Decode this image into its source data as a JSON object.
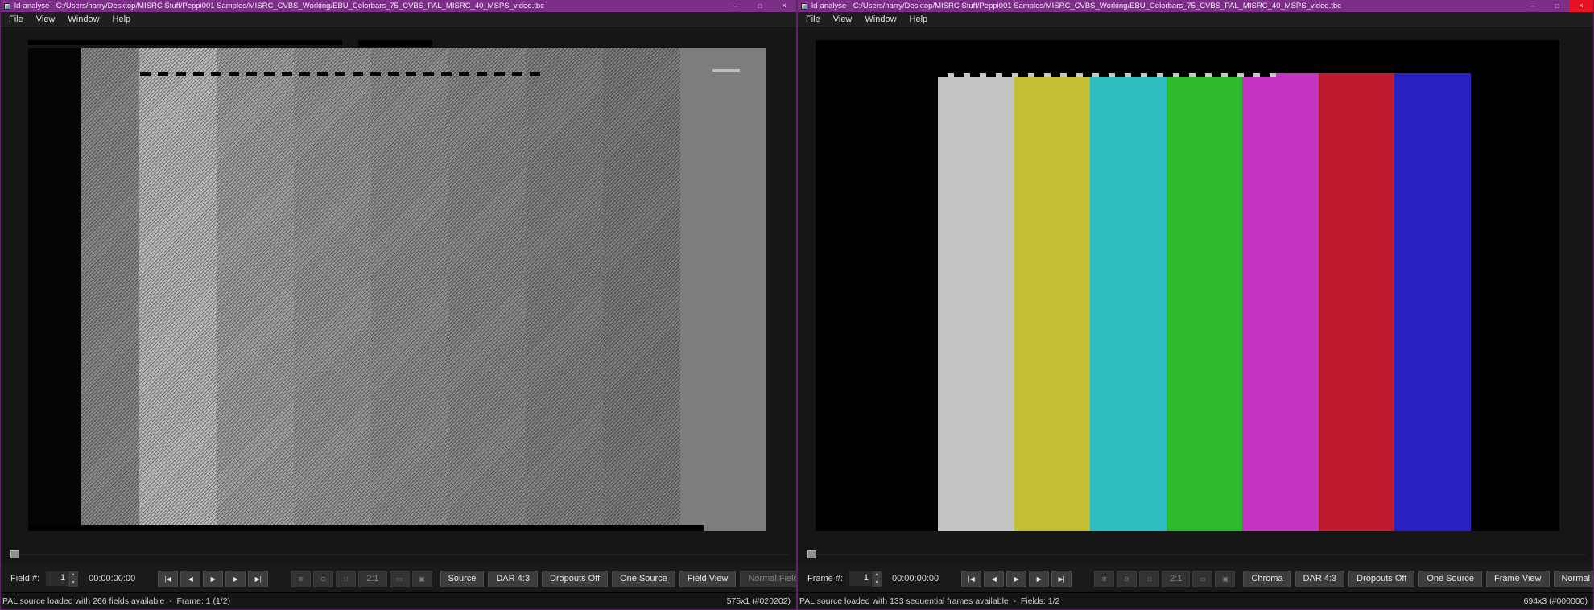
{
  "icons": {
    "minimize": "–",
    "maximize": "□",
    "close": "×",
    "spin_up": "▲",
    "spin_down": "▼",
    "playback": [
      "|◀",
      "◀",
      "▶",
      "▶",
      "▶|"
    ],
    "zoom": [
      "⊕",
      "⊖",
      "□"
    ],
    "zoom_extra": [
      "▭",
      "▣"
    ]
  },
  "colors": {
    "titlebar_accent": "#7c2f87",
    "close_button_red": "#e81123",
    "luma_pixel_readout": "#020202",
    "chroma_pixel_readout": "#000000"
  },
  "windows": [
    {
      "title": "ld-analyse - C:/Users/harry/Desktop/MISRC Stuff/Peppi001 Samples/MISRC_CVBS_Working/EBU_Colorbars_75_CVBS_PAL_MISRC_40_MSPS_video.tbc",
      "menu": [
        "File",
        "View",
        "Window",
        "Help"
      ],
      "toolbar": {
        "position_label": "Field #:",
        "position_value": "1",
        "timecode": "00:00:00:00",
        "zoom_ratio": "2:1",
        "toggles": [
          "Source",
          "DAR 4:3",
          "Dropouts Off",
          "One Source",
          "Field View",
          "Normal Field-order"
        ]
      },
      "status": {
        "left": "PAL source loaded with 266 fields available  -  Frame: 1 (1/2)",
        "right": "575x1 (#020202)"
      },
      "video": {
        "description": "luma source view of EBU 75% colorbars with chroma dot texture",
        "columns": [
          "#050505",
          "#8e8e8e",
          "#c0c0c0",
          "#a6a6a6",
          "#9c9c9c",
          "#959595",
          "#8f8f8f",
          "#888888",
          "#828282",
          "#7d7d7d"
        ]
      }
    },
    {
      "title": "ld-analyse - C:/Users/harry/Desktop/MISRC Stuff/Peppi001 Samples/MISRC_CVBS_Working/EBU_Colorbars_75_CVBS_PAL_MISRC_40_MSPS_video.tbc",
      "menu": [
        "File",
        "View",
        "Window",
        "Help"
      ],
      "toolbar": {
        "position_label": "Frame #:",
        "position_value": "1",
        "timecode": "00:00:00:00",
        "zoom_ratio": "2:1",
        "toggles": [
          "Chroma",
          "DAR 4:3",
          "Dropouts Off",
          "One Source",
          "Frame View",
          "Normal Field-order"
        ]
      },
      "status": {
        "left": "PAL source loaded with 133 sequential frames available  -  Fields: 1/2",
        "right": "694x3 (#000000)"
      },
      "video": {
        "description": "decoded chroma view of EBU 75% colorbars",
        "bars": [
          "#c3c3c3",
          "#c3bf35",
          "#2fbdbf",
          "#2cb92c",
          "#c334c3",
          "#bf1b2e",
          "#2b21c1"
        ]
      }
    }
  ]
}
